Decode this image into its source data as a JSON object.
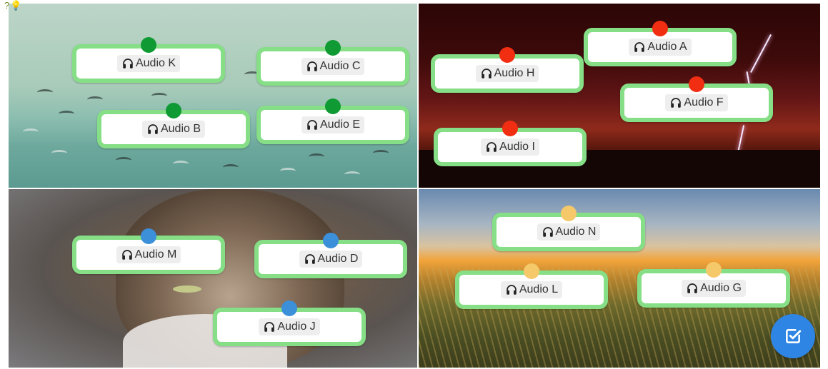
{
  "colors": {
    "card_border": "#86df86",
    "dot_green": "#0f9a33",
    "dot_red": "#f12e12",
    "dot_blue": "#3c8fd9",
    "dot_yellow": "#f5c86a",
    "submit_button": "#2f85e4"
  },
  "top_icons": {
    "question": "?",
    "bulb": "💡"
  },
  "quadrants": [
    {
      "name": "birds-image",
      "cards": [
        {
          "label": "Audio K",
          "icon": "headphones-icon",
          "dot": "#0f9a33"
        },
        {
          "label": "Audio C",
          "icon": "headphones-icon",
          "dot": "#0f9a33"
        },
        {
          "label": "Audio B",
          "icon": "headphones-icon",
          "dot": "#0f9a33"
        },
        {
          "label": "Audio E",
          "icon": "headphones-icon",
          "dot": "#0f9a33"
        }
      ]
    },
    {
      "name": "storm-image",
      "cards": [
        {
          "label": "Audio A",
          "icon": "headphones-icon",
          "dot": "#f12e12"
        },
        {
          "label": "Audio H",
          "icon": "headphones-icon",
          "dot": "#f12e12"
        },
        {
          "label": "Audio F",
          "icon": "headphones-icon",
          "dot": "#f12e12"
        },
        {
          "label": "Audio I",
          "icon": "headphones-icon",
          "dot": "#f12e12"
        }
      ]
    },
    {
      "name": "cat-image",
      "cards": [
        {
          "label": "Audio M",
          "icon": "headphones-icon",
          "dot": "#3c8fd9"
        },
        {
          "label": "Audio D",
          "icon": "headphones-icon",
          "dot": "#3c8fd9"
        },
        {
          "label": "Audio J",
          "icon": "headphones-icon",
          "dot": "#3c8fd9"
        }
      ]
    },
    {
      "name": "field-image",
      "cards": [
        {
          "label": "Audio N",
          "icon": "headphones-icon",
          "dot": "#f5c86a"
        },
        {
          "label": "Audio L",
          "icon": "headphones-icon",
          "dot": "#f5c86a"
        },
        {
          "label": "Audio G",
          "icon": "headphones-icon",
          "dot": "#f5c86a"
        }
      ]
    }
  ],
  "submit_icon": "check-square-icon"
}
